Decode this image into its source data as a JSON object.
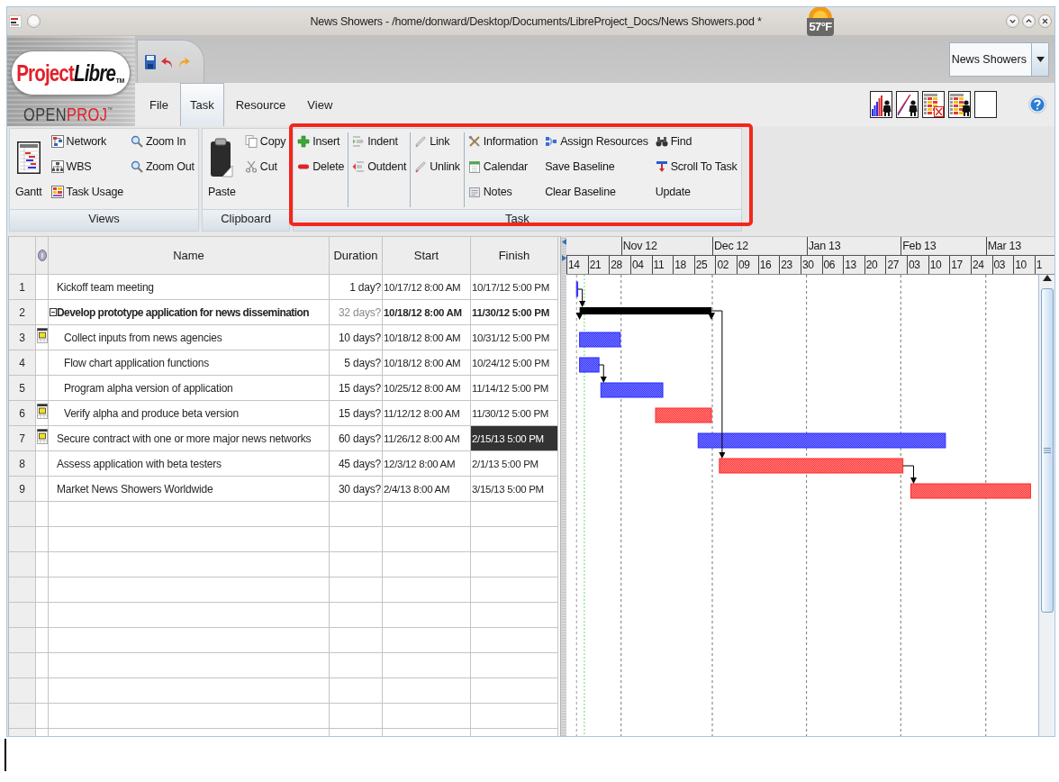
{
  "window": {
    "title": "News Showers - /home/donward/Desktop/Documents/LibreProject_Docs/News Showers.pod *"
  },
  "weather": {
    "temperature": "57°F"
  },
  "logo": {
    "wordmark": [
      "Project",
      "Libre"
    ],
    "trademark": "TM",
    "product": [
      "OPEN",
      "PROJ"
    ],
    "product_mark": "™"
  },
  "project_selector": {
    "value": "News Showers"
  },
  "menu_tabs": [
    {
      "label": "File",
      "selected": false
    },
    {
      "label": "Task",
      "selected": true
    },
    {
      "label": "Resource",
      "selected": false
    },
    {
      "label": "View",
      "selected": false
    }
  ],
  "ribbon": {
    "groups": [
      {
        "label": "Views",
        "highlighted": false,
        "sections": [
          {
            "columns": [
              [
                {
                  "label": "Gantt",
                  "kind": "large"
                }
              ],
              [
                {
                  "label": "Network",
                  "kind": "small"
                },
                {
                  "label": "WBS",
                  "kind": "small"
                },
                {
                  "label": "Task Usage",
                  "kind": "small"
                }
              ],
              [
                {
                  "label": "Zoom In",
                  "kind": "small"
                },
                {
                  "label": "Zoom Out",
                  "kind": "small"
                }
              ]
            ]
          }
        ]
      },
      {
        "label": "Clipboard",
        "highlighted": false,
        "sections": [
          {
            "columns": [
              [
                {
                  "label": "Paste",
                  "kind": "large"
                }
              ],
              [
                {
                  "label": "Copy",
                  "kind": "small"
                },
                {
                  "label": "Cut",
                  "kind": "small"
                }
              ]
            ]
          }
        ]
      },
      {
        "label": "Task",
        "highlighted": true,
        "sections": [
          {
            "columns": [
              [
                {
                  "label": "Insert",
                  "kind": "small"
                },
                {
                  "label": "Delete",
                  "kind": "small"
                }
              ]
            ]
          },
          {
            "columns": [
              [
                {
                  "label": "Indent",
                  "kind": "small"
                },
                {
                  "label": "Outdent",
                  "kind": "small"
                }
              ]
            ]
          },
          {
            "columns": [
              [
                {
                  "label": "Link",
                  "kind": "small"
                },
                {
                  "label": "Unlink",
                  "kind": "small"
                }
              ]
            ]
          },
          {
            "columns": [
              [
                {
                  "label": "Information",
                  "kind": "small"
                },
                {
                  "label": "Calendar",
                  "kind": "small"
                },
                {
                  "label": "Notes",
                  "kind": "small"
                }
              ],
              [
                {
                  "label": "Assign Resources",
                  "kind": "small"
                },
                {
                  "label": "Save Baseline",
                  "kind": "small"
                },
                {
                  "label": "Clear Baseline",
                  "kind": "small"
                }
              ],
              [
                {
                  "label": "Find",
                  "kind": "small"
                },
                {
                  "label": "Scroll To Task",
                  "kind": "small"
                },
                {
                  "label": "Update",
                  "kind": "small"
                }
              ]
            ]
          }
        ]
      }
    ]
  },
  "task_table": {
    "columns": [
      "Name",
      "Duration",
      "Start",
      "Finish"
    ],
    "rows": [
      {
        "num": "1",
        "name": "Kickoff team meeting",
        "duration": "1 day?",
        "start": "10/17/12 8:00 AM",
        "finish": "10/17/12 5:00 PM",
        "kind": "task",
        "indicator": false,
        "critical": false,
        "finish_selected": false,
        "linked": true
      },
      {
        "num": "2",
        "name": "Develop prototype application for news dissemination",
        "duration": "32 days?",
        "start": "10/18/12 8:00 AM",
        "finish": "11/30/12 5:00 PM",
        "kind": "summary",
        "expanded": true,
        "indicator": false,
        "finish_selected": false,
        "linked": true,
        "children": [
          {
            "num": "3",
            "name": "Collect inputs from news agencies",
            "duration": "10 days?",
            "start": "10/18/12 8:00 AM",
            "finish": "10/31/12 5:00 PM",
            "kind": "task",
            "indicator": true,
            "critical": false,
            "finish_selected": false,
            "linked": false
          },
          {
            "num": "4",
            "name": "Flow chart application functions",
            "duration": "5 days?",
            "start": "10/18/12 8:00 AM",
            "finish": "10/24/12 5:00 PM",
            "kind": "task",
            "indicator": false,
            "critical": false,
            "finish_selected": false,
            "linked": true
          },
          {
            "num": "5",
            "name": "Program alpha version of application",
            "duration": "15 days?",
            "start": "10/25/12 8:00 AM",
            "finish": "11/14/12 5:00 PM",
            "kind": "task",
            "indicator": false,
            "critical": false,
            "finish_selected": false,
            "linked": false
          },
          {
            "num": "6",
            "name": "Verify alpha and produce beta version",
            "duration": "15 days?",
            "start": "11/12/12 8:00 AM",
            "finish": "11/30/12 5:00 PM",
            "kind": "task",
            "indicator": true,
            "critical": true,
            "finish_selected": false,
            "linked": false
          }
        ]
      },
      {
        "num": "7",
        "name": "Secure contract with one or more major news networks",
        "duration": "60 days?",
        "start": "11/26/12 8:00 AM",
        "finish": "2/15/13 5:00 PM",
        "kind": "task",
        "indicator": true,
        "critical": false,
        "finish_selected": true,
        "linked": false
      },
      {
        "num": "8",
        "name": "Assess application with beta testers",
        "duration": "45 days?",
        "start": "12/3/12 8:00 AM",
        "finish": "2/1/13 5:00 PM",
        "kind": "task",
        "indicator": false,
        "critical": true,
        "finish_selected": false,
        "linked": true
      },
      {
        "num": "9",
        "name": "Market News Showers Worldwide",
        "duration": "30 days?",
        "start": "2/4/13 8:00 AM",
        "finish": "3/15/13 5:00 PM",
        "kind": "task",
        "indicator": false,
        "critical": true,
        "finish_selected": false,
        "linked": false
      }
    ]
  },
  "gantt": {
    "months": [
      "Nov 12",
      "Dec 12",
      "Jan 13",
      "Feb 13",
      "Mar 13"
    ],
    "weeks": [
      "14",
      "21",
      "28",
      "04",
      "11",
      "18",
      "25",
      "02",
      "09",
      "16",
      "23",
      "30",
      "06",
      "13",
      "20",
      "27",
      "03",
      "10",
      "17",
      "24",
      "03",
      "10",
      "1"
    ]
  }
}
